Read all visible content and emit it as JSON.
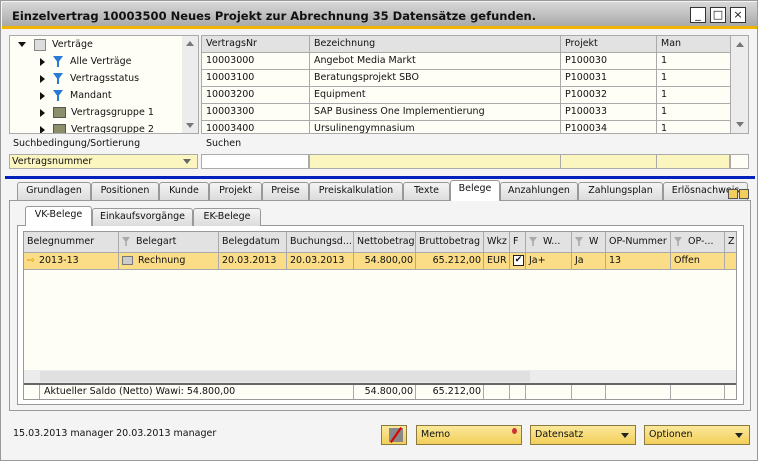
{
  "window": {
    "title": "Einzelvertrag 10003500 Neues Projekt zur Abrechnung  35 Datensätze gefunden.",
    "minimize": "_",
    "maximize": "□",
    "close": "×"
  },
  "tree": {
    "root": "Verträge",
    "items": [
      {
        "label": "Alle Verträge",
        "icon": "filter-icon"
      },
      {
        "label": "Vertragsstatus",
        "icon": "filter-icon"
      },
      {
        "label": "Mandant",
        "icon": "filter-icon"
      },
      {
        "label": "Vertragsgruppe 1",
        "icon": "folder-icon"
      },
      {
        "label": "Vertragsgruppe 2",
        "icon": "folder-icon"
      }
    ]
  },
  "list": {
    "columns": [
      "VertragsNr",
      "Bezeichnung",
      "Projekt",
      "Man"
    ],
    "rows": [
      [
        "10003000",
        "Angebot Media Markt",
        "P100030",
        "1"
      ],
      [
        "10003100",
        "Beratungsprojekt SBO",
        "P100031",
        "1"
      ],
      [
        "10003200",
        "Equipment",
        "P100032",
        "1"
      ],
      [
        "10003300",
        "SAP Business One Implementierung",
        "P100033",
        "1"
      ],
      [
        "10003400",
        "Ursulinengymnasium",
        "P100034",
        "1"
      ]
    ]
  },
  "search": {
    "condition_label": "Suchbedingung/Sortierung",
    "condition_value": "Vertragsnummer",
    "search_label": "Suchen",
    "search_value": ""
  },
  "tabs": [
    "Grundlagen",
    "Positionen",
    "Kunde",
    "Projekt",
    "Preise",
    "Preiskalkulation",
    "Texte",
    "Belege",
    "Anzahlungen",
    "Zahlungsplan",
    "Erlösnachweis"
  ],
  "active_tab": "Belege",
  "subtabs": [
    "VK-Belege",
    "Einkaufsvorgänge",
    "EK-Belege"
  ],
  "belege": {
    "columns": [
      "Belegnummer",
      "Belegart",
      "Belegdatum",
      "Buchungsd...",
      "Nettobetrag",
      "Bruttobetrag",
      "Wkz",
      "F",
      "W...",
      "W",
      "OP-Nummer",
      "OP-...",
      "Z"
    ],
    "rows": [
      [
        "2013-13",
        "Rechnung",
        "20.03.2013",
        "20.03.2013",
        "54.800,00",
        "65.212,00",
        "EUR",
        "checked",
        "Ja+",
        "Ja",
        "13",
        "Offen",
        ""
      ]
    ],
    "footer": {
      "label": "Aktueller Saldo (Netto) Wawi: 54.800,00",
      "netto": "54.800,00",
      "brutto": "65.212,00"
    }
  },
  "status": "15.03.2013 manager   20.03.2013 manager",
  "buttons": {
    "memo": "Memo",
    "datensatz": "Datensatz",
    "optionen": "Optionen"
  },
  "colors": {
    "accent": "#f0b400",
    "selection": "#fbdd88",
    "blue_line": "#0022bb"
  }
}
